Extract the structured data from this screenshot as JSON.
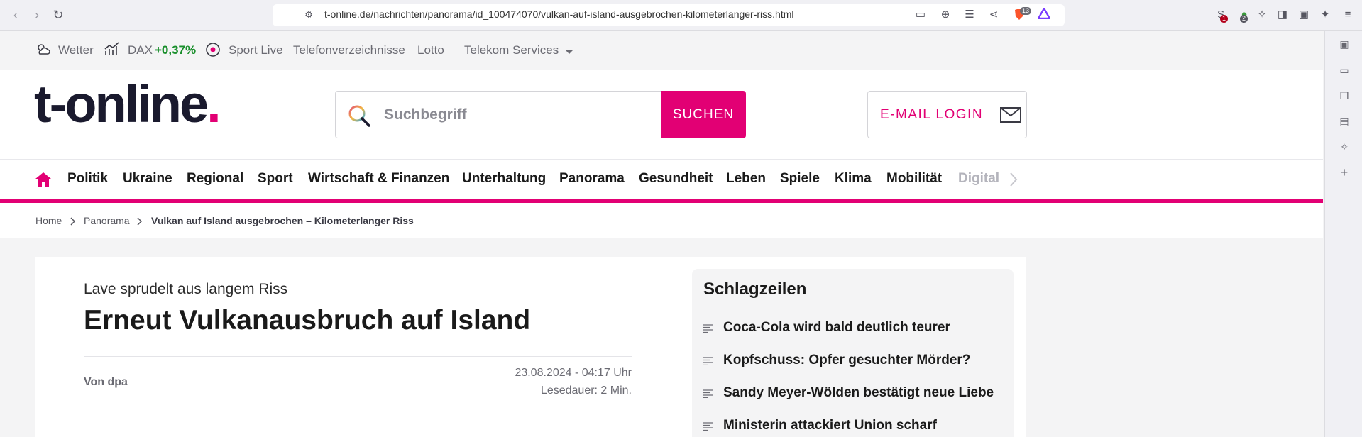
{
  "browser": {
    "url": "t-online.de/nachrichten/panorama/id_100474070/vulkan-auf-island-ausgebrochen-kilometerlanger-riss.html",
    "badges": {
      "brave": "13",
      "ext1": "1",
      "ext2": "2"
    }
  },
  "topbar": {
    "weather": "Wetter",
    "dax_label": "DAX",
    "dax_value": "+0,37%",
    "sport_live": "Sport Live",
    "phonebook": "Telefonverzeichnisse",
    "lotto": "Lotto",
    "telekom": "Telekom Services"
  },
  "header": {
    "logo_text": "t-online",
    "logo_dot": ".",
    "search_placeholder": "Suchbegriff",
    "search_button": "SUCHEN",
    "email_login": "E-MAIL LOGIN"
  },
  "nav": {
    "items": [
      "Politik",
      "Ukraine",
      "Regional",
      "Sport",
      "Wirtschaft & Finanzen",
      "Unterhaltung",
      "Panorama",
      "Gesundheit",
      "Leben",
      "Spiele",
      "Klima",
      "Mobilität",
      "Digital"
    ]
  },
  "breadcrumb": {
    "home": "Home",
    "section": "Panorama",
    "current": "Vulkan auf Island ausgebrochen – Kilometerlanger Riss"
  },
  "article": {
    "kicker": "Lave sprudelt aus langem Riss",
    "title": "Erneut Vulkanausbruch auf Island",
    "author": "Von dpa",
    "date": "23.08.2024 - 04:17 Uhr",
    "reading_time": "Lesedauer: 2 Min."
  },
  "headlines": {
    "title": "Schlagzeilen",
    "items": [
      "Coca-Cola wird bald deutlich teurer",
      "Kopfschuss: Opfer gesuchter Mörder?",
      "Sandy Meyer-Wölden bestätigt neue Liebe",
      "Ministerin attackiert Union scharf"
    ]
  },
  "colors": {
    "brand": "#e20074",
    "positive": "#1a8f2c",
    "text": "#1a1a1a"
  }
}
